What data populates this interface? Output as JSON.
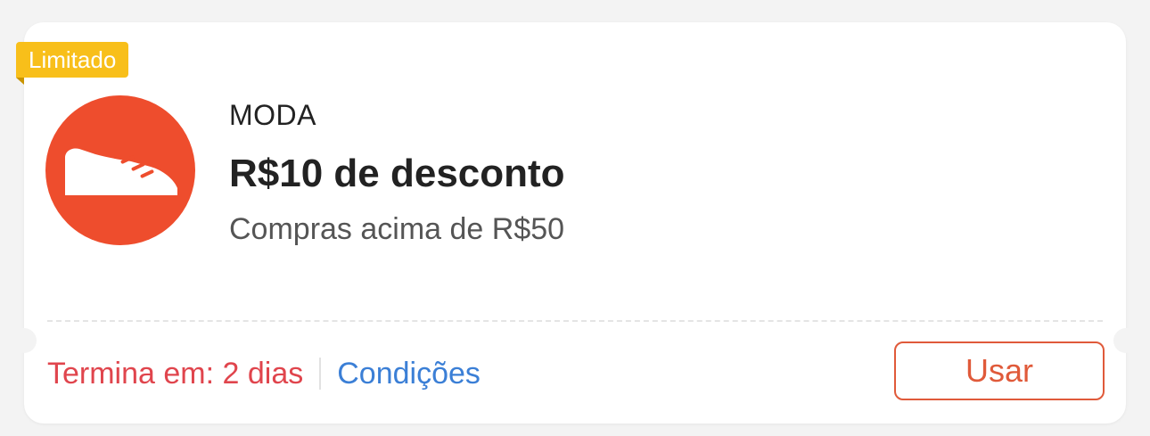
{
  "badge": {
    "label": "Limitado",
    "color": "#f8bf1a"
  },
  "coupon": {
    "icon": "sneaker-icon",
    "icon_bg_color": "#ee4d2d",
    "category": "MODA",
    "title": "R$10 de desconto",
    "subtitle": "Compras acima de R$50"
  },
  "footer": {
    "expiry": "Termina em: 2 dias",
    "expiry_color": "#e0454d",
    "conditions": "Condições",
    "conditions_color": "#3b7fd6",
    "use_button": "Usar",
    "use_button_color": "#e05a3a"
  }
}
